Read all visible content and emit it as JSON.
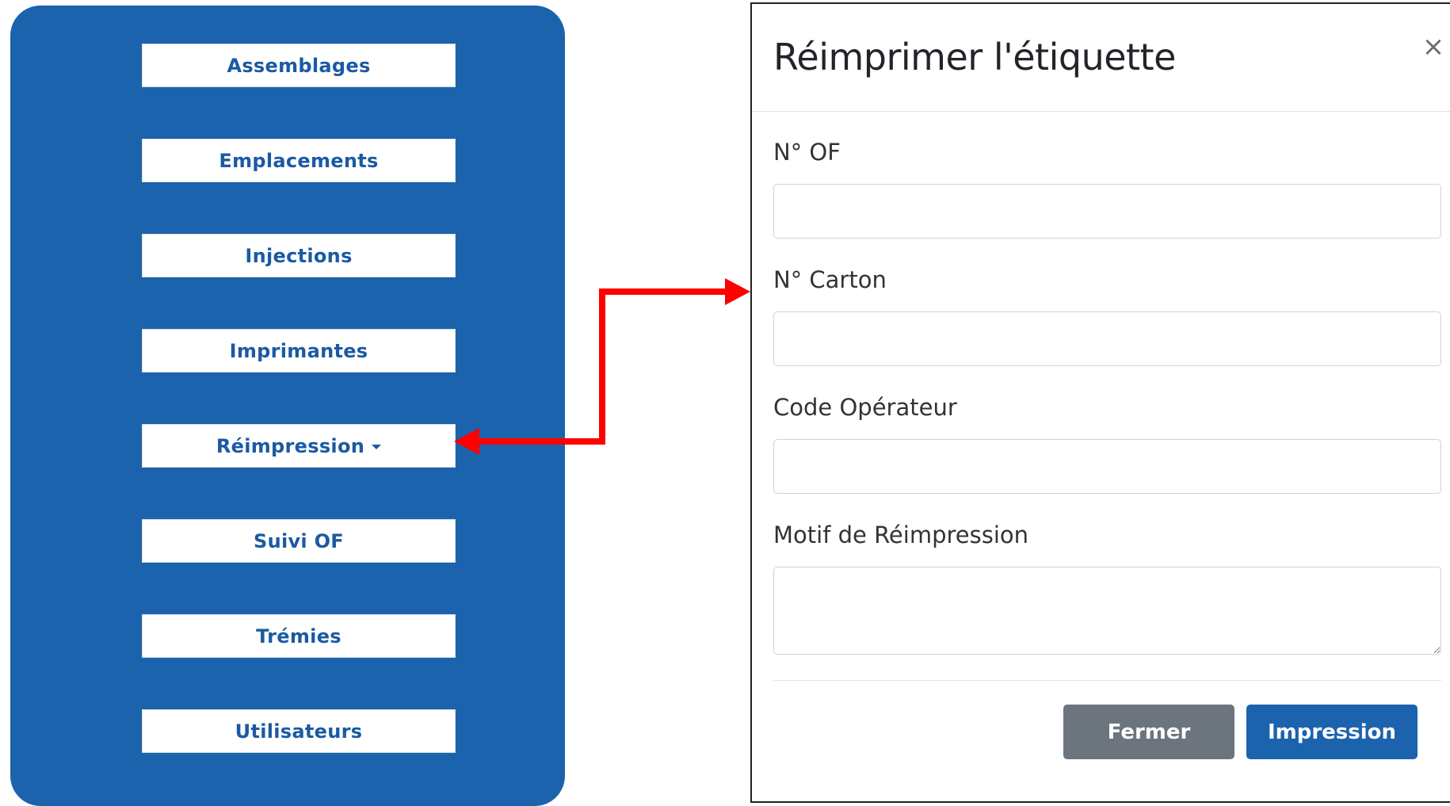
{
  "sidebar": {
    "items": [
      {
        "label": "Assemblages"
      },
      {
        "label": "Emplacements"
      },
      {
        "label": "Injections"
      },
      {
        "label": "Imprimantes"
      },
      {
        "label": "Réimpression"
      },
      {
        "label": "Suivi OF"
      },
      {
        "label": "Trémies"
      },
      {
        "label": "Utilisateurs"
      }
    ]
  },
  "modal": {
    "title": "Réimprimer l'étiquette",
    "close_symbol": "×",
    "fields": [
      {
        "label": "N° OF",
        "value": ""
      },
      {
        "label": "N° Carton",
        "value": ""
      },
      {
        "label": "Code Opérateur",
        "value": ""
      },
      {
        "label": "Motif de Réimpression",
        "value": ""
      }
    ],
    "buttons": {
      "close_label": "Fermer",
      "print_label": "Impression"
    }
  },
  "colors": {
    "sidebar_bg": "#1b63ac",
    "menu_text": "#1b5aa3",
    "arrow": "#ff0000",
    "secondary_button": "#6c757d",
    "primary_button": "#1b63ac"
  },
  "icons": {
    "dropdown": "caret-down-icon",
    "close": "close-icon",
    "connector": "double-headed-arrow"
  }
}
